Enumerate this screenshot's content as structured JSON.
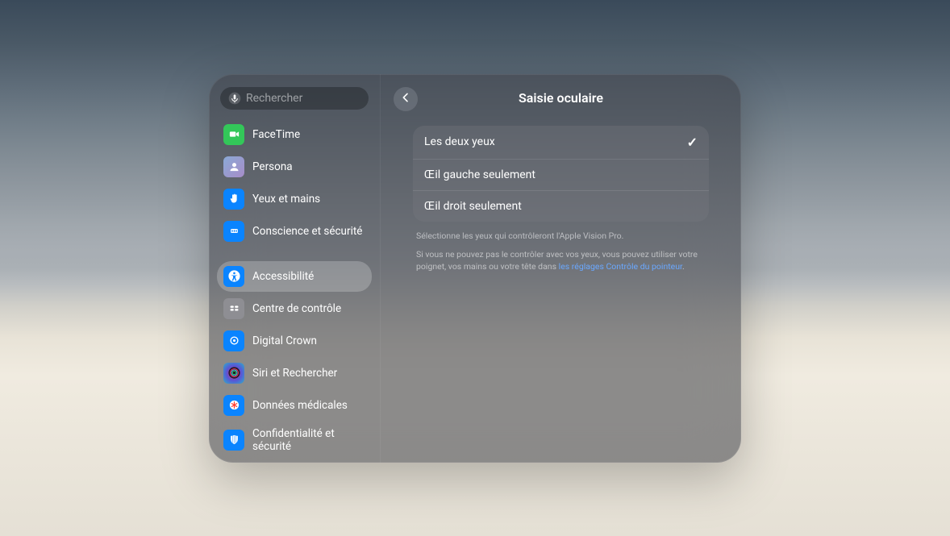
{
  "search": {
    "placeholder": "Rechercher"
  },
  "sidebar": {
    "items": [
      {
        "label": "FaceTime",
        "icon": "facetime",
        "bg": "#33c759"
      },
      {
        "label": "Persona",
        "icon": "persona",
        "bg": "linear-gradient(135deg,#8aa9d6,#a78dc8)"
      },
      {
        "label": "Yeux et mains",
        "icon": "hand",
        "bg": "#0a84ff"
      },
      {
        "label": "Conscience et sécurité",
        "icon": "dial",
        "bg": "#0a84ff"
      },
      {
        "_gap": true
      },
      {
        "label": "Accessibilité",
        "icon": "accessibility",
        "bg": "#0a84ff",
        "selected": true
      },
      {
        "label": "Centre de contrôle",
        "icon": "control",
        "bg": "#8e8e93"
      },
      {
        "label": "Digital Crown",
        "icon": "crown",
        "bg": "#0a84ff"
      },
      {
        "label": "Siri et Rechercher",
        "icon": "siri",
        "bg": "radial-gradient(circle,#ff2d55,#5856d6,#30b0c7)"
      },
      {
        "label": "Données médicales",
        "icon": "medical",
        "bg": "#0a84ff"
      },
      {
        "label": "Confidentialité et sécurité",
        "icon": "privacy",
        "bg": "#0a84ff"
      }
    ]
  },
  "page": {
    "title": "Saisie oculaire"
  },
  "options": [
    {
      "label": "Les deux yeux",
      "selected": true
    },
    {
      "label": "Œil gauche seulement",
      "selected": false
    },
    {
      "label": "Œil droit seulement",
      "selected": false
    }
  ],
  "help": {
    "line1": "Sélectionne les yeux qui contrôleront l'Apple Vision Pro.",
    "line2a": "Si vous ne pouvez pas le contrôler avec vos yeux, vous pouvez utiliser votre poignet, vos mains ou votre tête dans ",
    "link": "les réglages Contrôle du pointeur",
    "line2b": "."
  }
}
